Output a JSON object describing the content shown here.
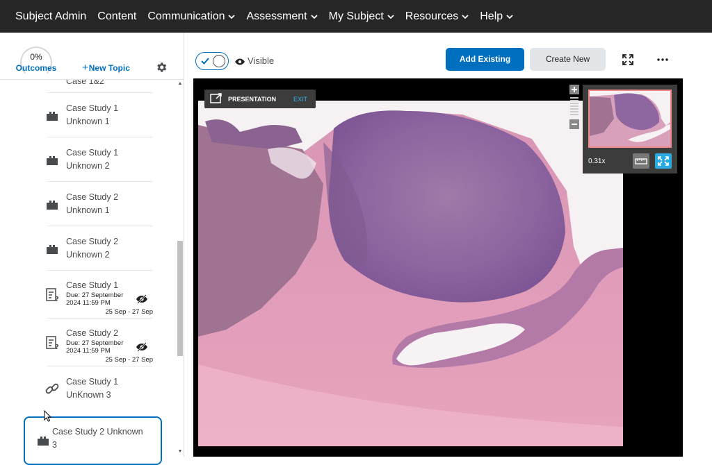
{
  "nav": {
    "items": [
      {
        "label": "Subject Admin",
        "has_menu": false
      },
      {
        "label": "Content",
        "has_menu": false
      },
      {
        "label": "Communication",
        "has_menu": true
      },
      {
        "label": "Assessment",
        "has_menu": true
      },
      {
        "label": "My Subject",
        "has_menu": true
      },
      {
        "label": "Resources",
        "has_menu": true
      },
      {
        "label": "Help",
        "has_menu": true
      }
    ]
  },
  "sidebar": {
    "outcomes_percent": "0%",
    "outcomes_label": "Outcomes",
    "new_topic_plus": "+",
    "new_topic_label": "New Topic",
    "partial_item_title": "Case 1&2",
    "items": [
      {
        "type": "scorm",
        "title1": "Case Study 1",
        "title2": "Unknown 1"
      },
      {
        "type": "scorm",
        "title1": "Case Study 1",
        "title2": "Unknown 2"
      },
      {
        "type": "scorm",
        "title1": "Case Study 2",
        "title2": "Unknown 1"
      },
      {
        "type": "scorm",
        "title1": "Case Study 2",
        "title2": "Unknown 2"
      },
      {
        "type": "quiz",
        "title1": "Case Study 1",
        "due1": "Due: 27 September",
        "due2": "2024 11:59 PM",
        "dates": "25 Sep - 27 Sep",
        "hidden": true
      },
      {
        "type": "quiz",
        "title1": "Case Study 2",
        "due1": "Due: 27 September",
        "due2": "2024 11:59 PM",
        "dates": "25 Sep - 27 Sep",
        "hidden": true
      },
      {
        "type": "link",
        "title1": "Case Study 1",
        "title2": "UnKnown 3"
      }
    ],
    "selected_item": {
      "title1": "Case Study 2 Unknown",
      "title2": "3"
    }
  },
  "toolbar": {
    "visibility_label": "Visible",
    "visibility_on": true,
    "add_existing_label": "Add Existing",
    "create_new_label": "Create New"
  },
  "viewer": {
    "presentation_label": "PRESENTATION",
    "exit_label": "EXIT",
    "zoom_level": "0.31x"
  },
  "colors": {
    "nav_bg": "#262626",
    "accent": "#006fbf",
    "viewer_bg": "#000000",
    "tissue_purple": "#8a5a95",
    "tissue_pink": "#e5a3bb"
  }
}
